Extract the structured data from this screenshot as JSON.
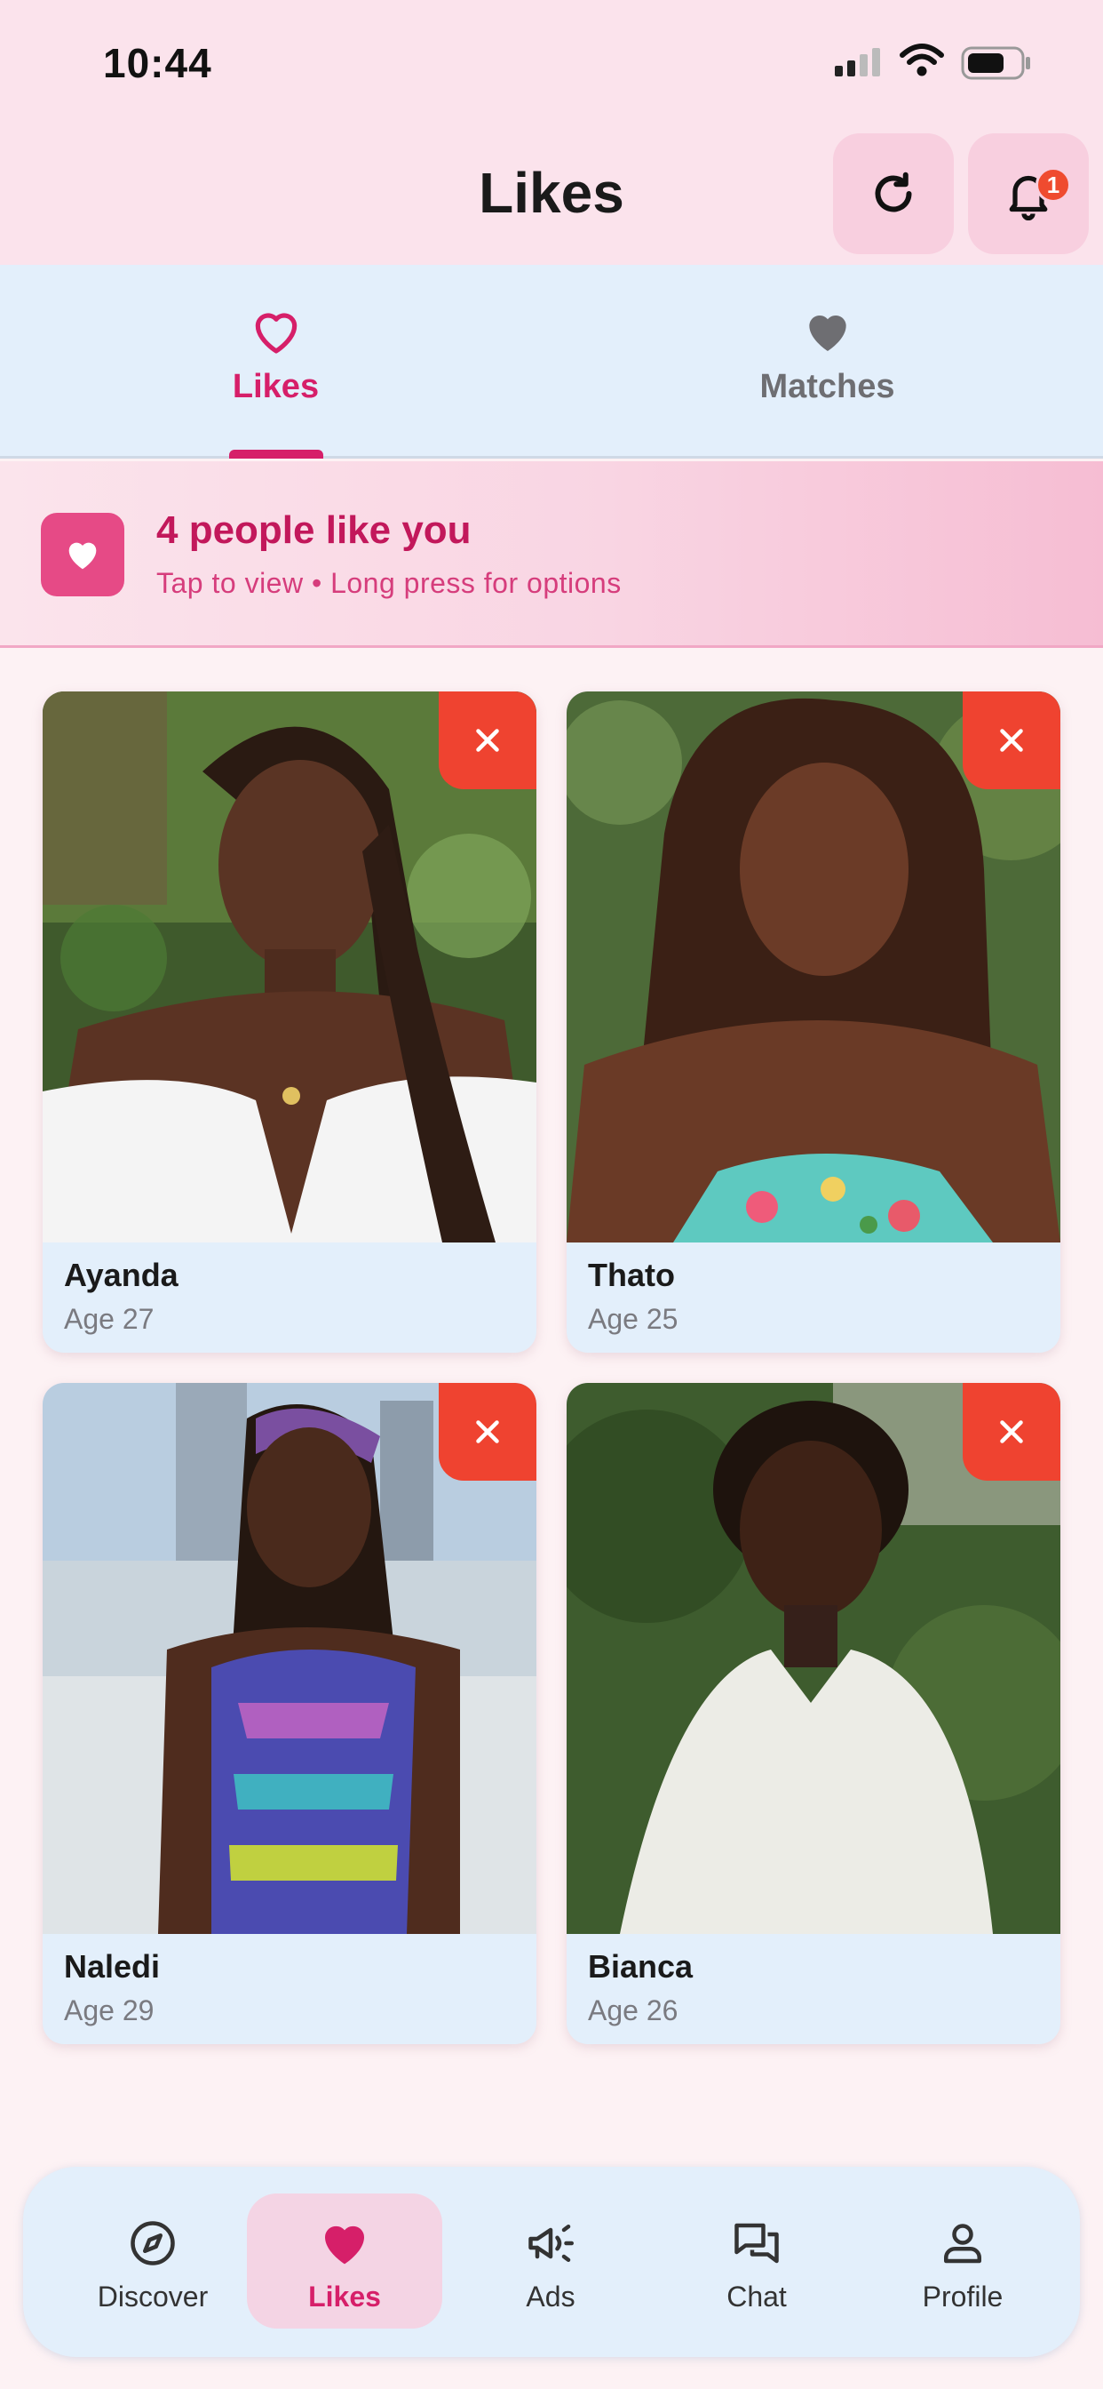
{
  "status_bar": {
    "time": "10:44"
  },
  "header": {
    "title": "Likes",
    "notification_count": "1"
  },
  "tabs": [
    {
      "label": "Likes",
      "icon": "heart-outline-icon",
      "active": true
    },
    {
      "label": "Matches",
      "icon": "heart-filled-icon",
      "active": false
    }
  ],
  "banner": {
    "title": "4 people like you",
    "subtitle": "Tap to view • Long press for options"
  },
  "profiles": [
    {
      "name": "Ayanda",
      "age": "Age 27"
    },
    {
      "name": "Thato",
      "age": "Age 25"
    },
    {
      "name": "Naledi",
      "age": "Age 29"
    },
    {
      "name": "Bianca",
      "age": "Age 26"
    }
  ],
  "nav": [
    {
      "label": "Discover",
      "icon": "compass-icon",
      "active": false
    },
    {
      "label": "Likes",
      "icon": "heart-icon",
      "active": true
    },
    {
      "label": "Ads",
      "icon": "megaphone-icon",
      "active": false
    },
    {
      "label": "Chat",
      "icon": "chat-icon",
      "active": false
    },
    {
      "label": "Profile",
      "icon": "person-icon",
      "active": false
    }
  ],
  "colors": {
    "accent": "#d61f69",
    "header_bg": "#fbe3ec",
    "tab_bg": "#e3effb",
    "dismiss": "#ef4330",
    "badge": "#ef4b2f"
  }
}
